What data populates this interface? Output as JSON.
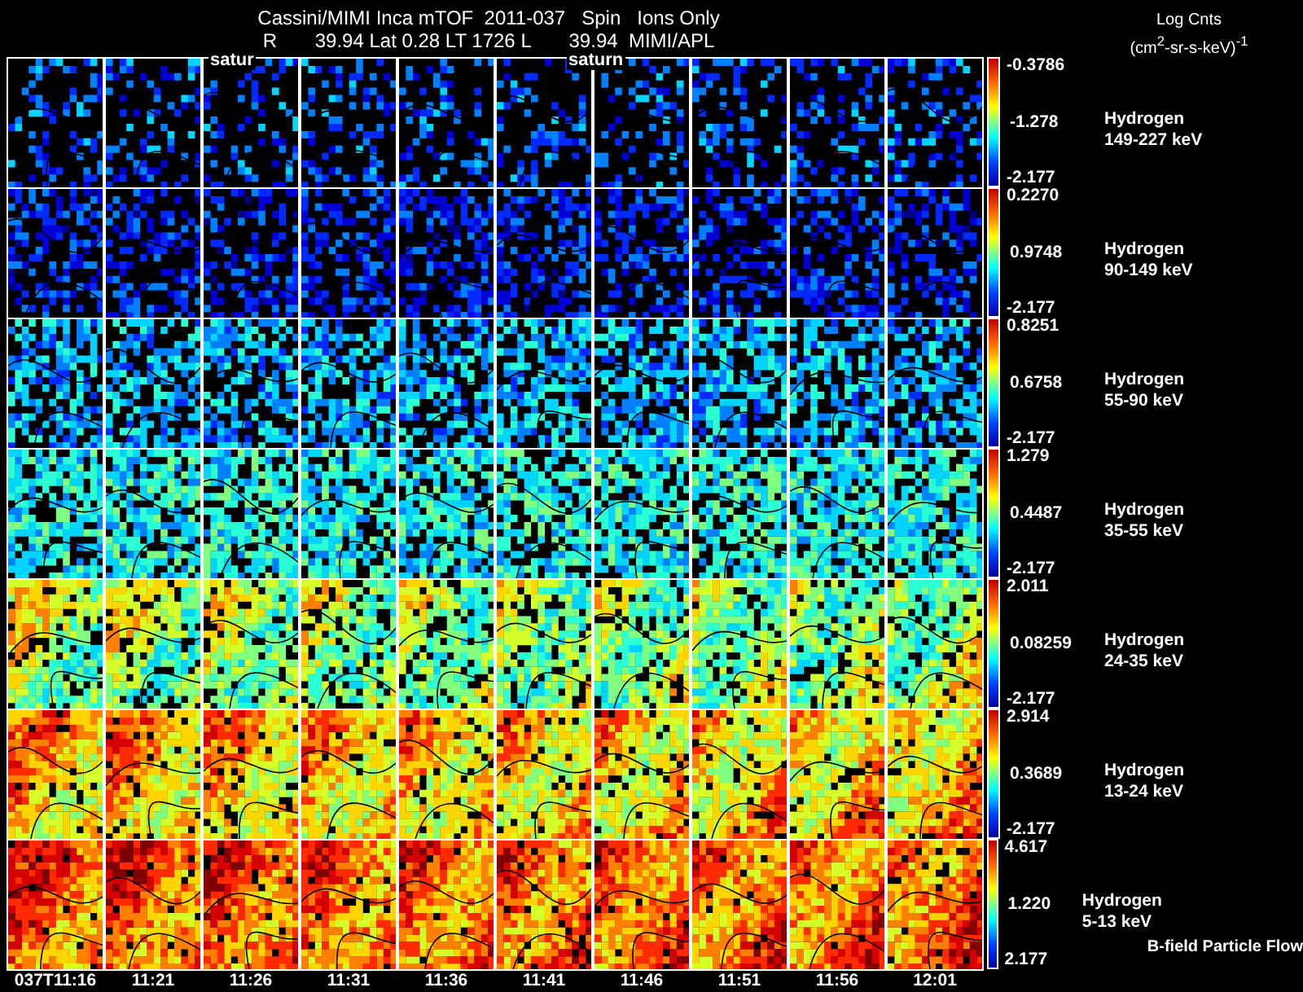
{
  "title": {
    "line_1": "Cassini/MIMI Inca mTOF  2011-037   Spin   Ions Only",
    "line_2": "R       39.94 Lat 0.28 LT 1726 L       39.94  MIMI/APL"
  },
  "units": {
    "label": "Log Cnts",
    "unit": "(cm$^{2}$-sr-s-keV)$^{-1}$"
  },
  "overlay_labels": [
    "satur",
    "saturn"
  ],
  "rows": [
    {
      "species": "Hydrogen",
      "energy": "149-227 keV",
      "max": "-0.3786",
      "mid": "-1.278",
      "min": "-2.177"
    },
    {
      "species": "Hydrogen",
      "energy": "90-149 keV",
      "max": "0.2270",
      "mid": "0.9748",
      "min": "-2.177"
    },
    {
      "species": "Hydrogen",
      "energy": "55-90 keV",
      "max": "0.8251",
      "mid": "0.6758",
      "min": "-2.177"
    },
    {
      "species": "Hydrogen",
      "energy": "35-55 keV",
      "max": "1.279",
      "mid": "0.4487",
      "min": "-2.177"
    },
    {
      "species": "Hydrogen",
      "energy": "24-35 keV",
      "max": "2.011",
      "mid": "0.08259",
      "min": "-2.177"
    },
    {
      "species": "Hydrogen",
      "energy": "13-24 keV",
      "max": "2.914",
      "mid": "0.3689",
      "min": "-2.177"
    },
    {
      "species": "Hydrogen",
      "energy": "5-13 keV",
      "max": "4.617",
      "mid": "1.220",
      "min": "2.177"
    }
  ],
  "footer": "B-field Particle Flow",
  "time_labels": [
    "037T11:16",
    "11:21",
    "11:26",
    "11:31",
    "11:36",
    "11:41",
    "11:46",
    "11:51",
    "11:56",
    "12:01"
  ]
}
